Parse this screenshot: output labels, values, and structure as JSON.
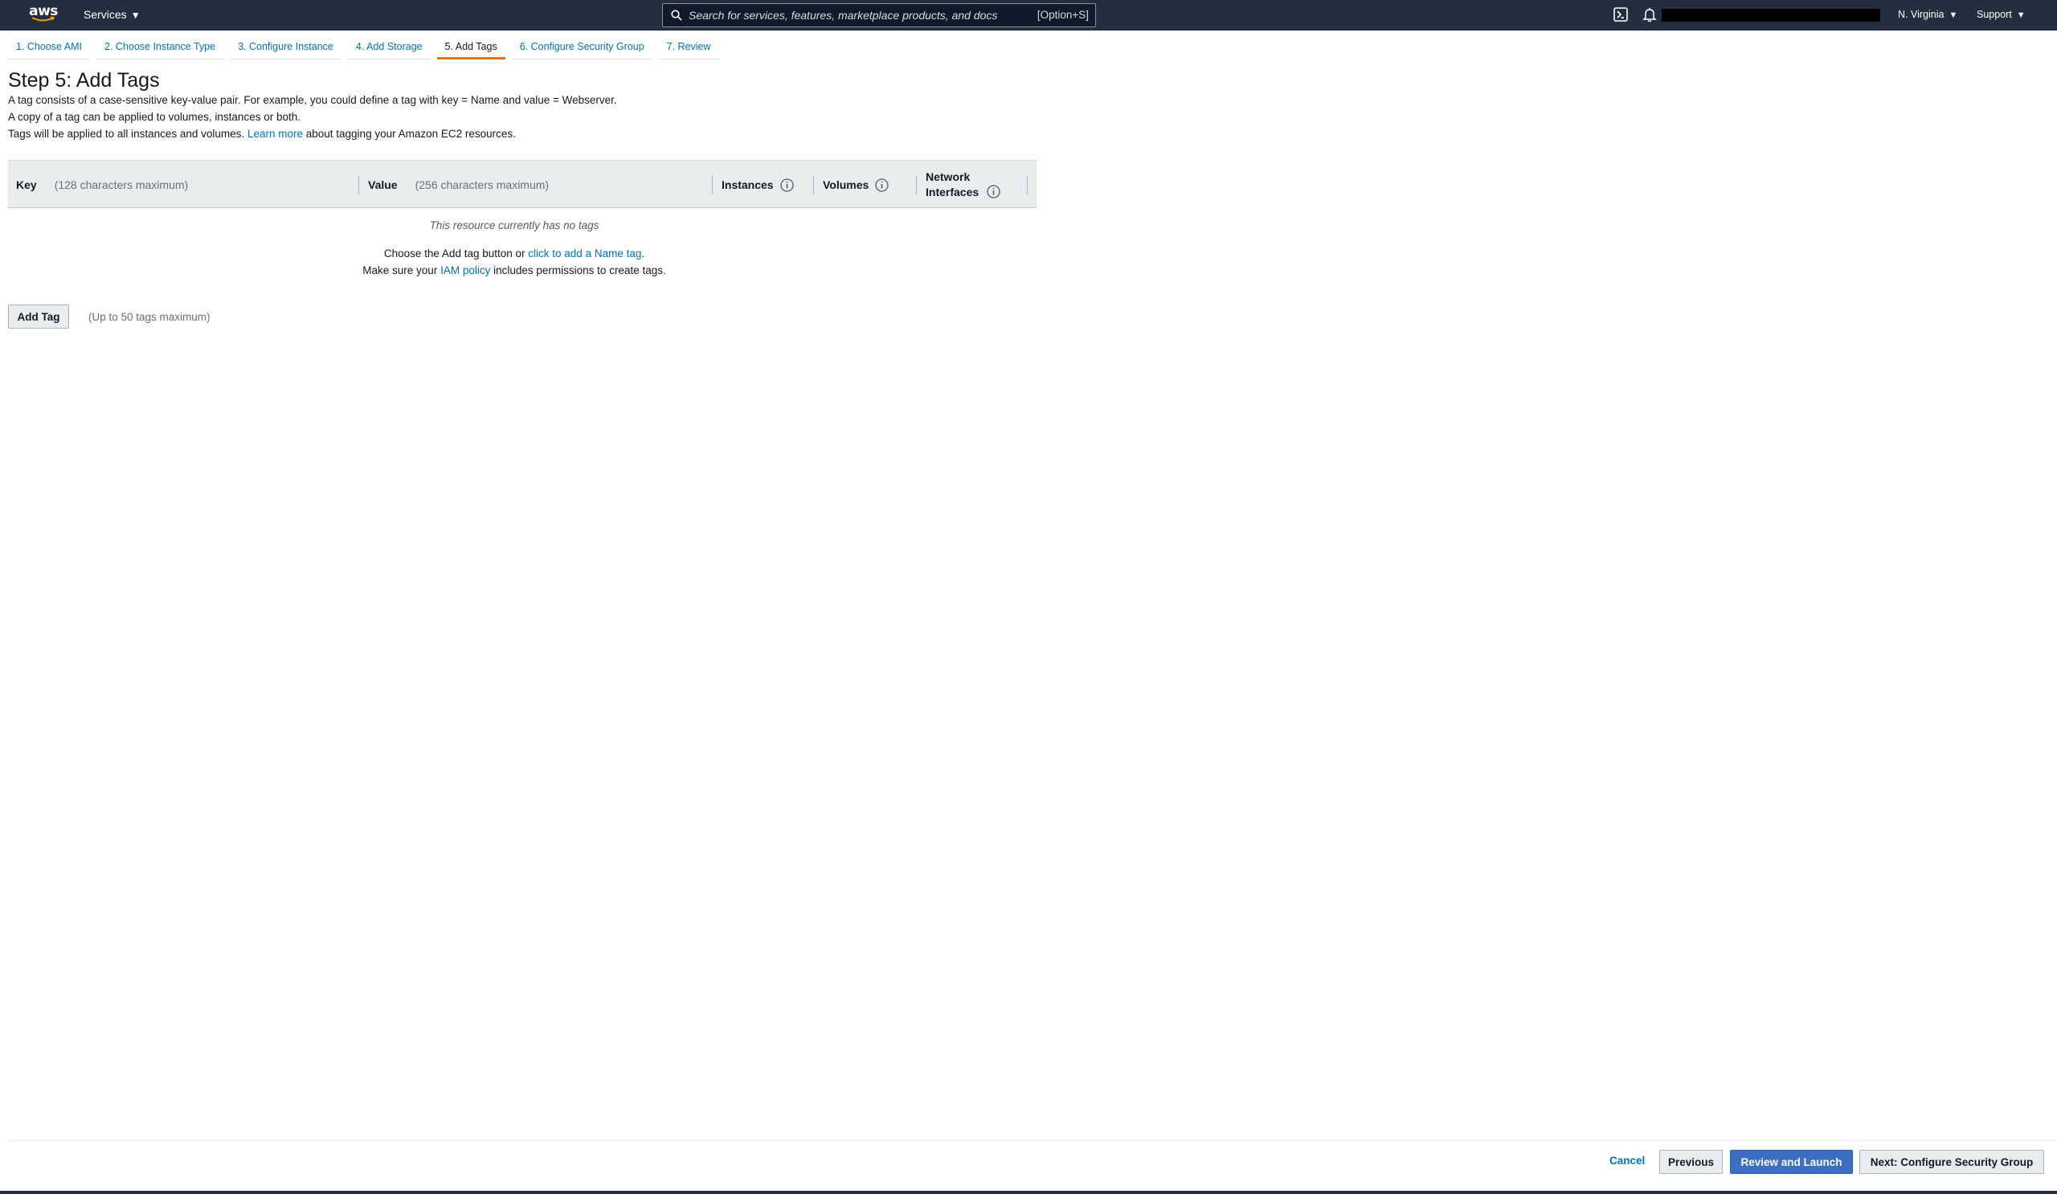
{
  "nav": {
    "logo": "aws",
    "services": "Services",
    "search_placeholder": "Search for services, features, marketplace products, and docs",
    "search_shortcut": "[Option+S]",
    "region": "N. Virginia",
    "support": "Support"
  },
  "steps": [
    {
      "label": "1. Choose AMI"
    },
    {
      "label": "2. Choose Instance Type"
    },
    {
      "label": "3. Configure Instance"
    },
    {
      "label": "4. Add Storage"
    },
    {
      "label": "5. Add Tags"
    },
    {
      "label": "6. Configure Security Group"
    },
    {
      "label": "7. Review"
    }
  ],
  "main": {
    "title": "Step 5: Add Tags",
    "desc_line1": "A tag consists of a case-sensitive key-value pair. For example, you could define a tag with key = Name and value = Webserver.",
    "desc_line2": "A copy of a tag can be applied to volumes, instances or both.",
    "desc_line3_pre": "Tags will be applied to all instances and volumes.",
    "learn_more": "Learn more",
    "desc_line3_post": "about tagging your Amazon EC2 resources."
  },
  "table": {
    "key_label": "Key",
    "key_hint": "(128 characters maximum)",
    "value_label": "Value",
    "value_hint": "(256 characters maximum)",
    "instances_label": "Instances",
    "volumes_label": "Volumes",
    "network_line1": "Network",
    "network_line2": "Interfaces"
  },
  "empty": {
    "message": "This resource currently has no tags",
    "choose_pre": "Choose the Add tag button or",
    "choose_link": "click to add a Name tag",
    "choose_post": ".",
    "iam_pre": "Make sure your",
    "iam_link": "IAM policy",
    "iam_post": "includes permissions to create tags."
  },
  "actions": {
    "add_tag": "Add Tag",
    "add_tag_hint": "(Up to 50 tags maximum)",
    "cancel": "Cancel",
    "previous": "Previous",
    "review_launch": "Review and Launch",
    "next": "Next: Configure Security Group"
  },
  "colors": {
    "nav_bg": "#232f3e",
    "link": "#0073bb",
    "active_tab": "#ec7211",
    "primary_button": "#3c6fc4"
  }
}
